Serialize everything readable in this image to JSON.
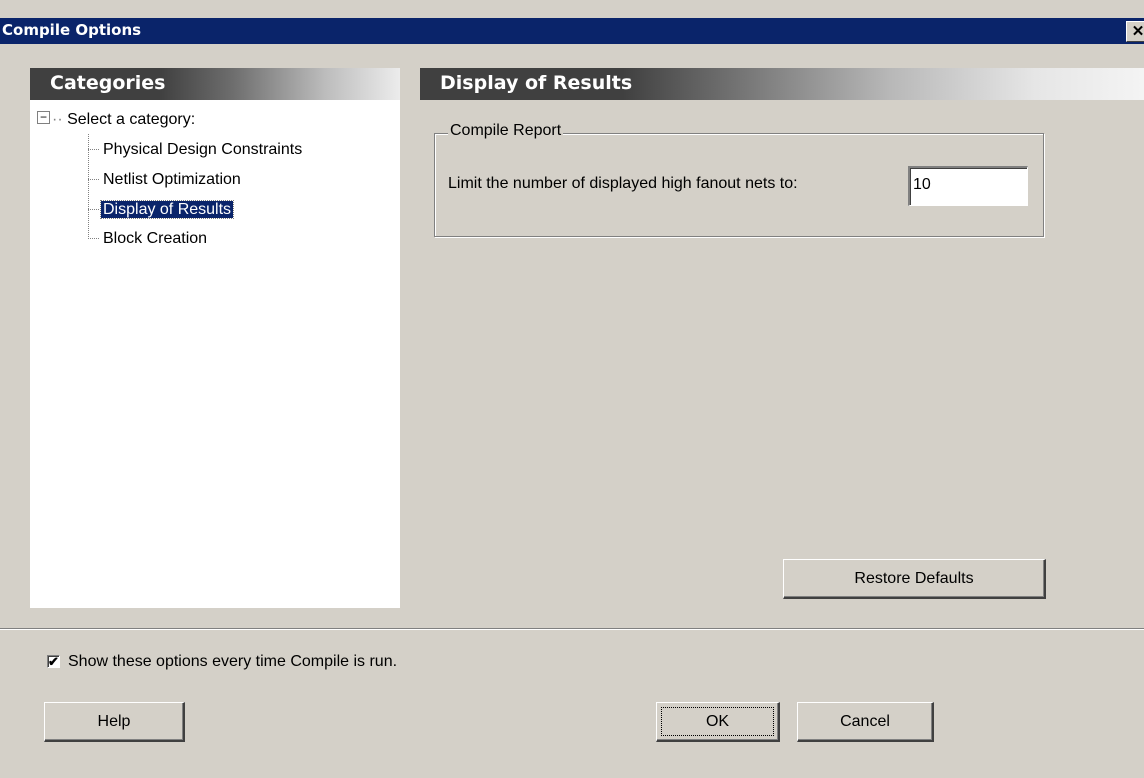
{
  "window": {
    "title": "Compile Options",
    "close_glyph": "✕"
  },
  "categories": {
    "header": "Categories",
    "root_label": "Select a category:",
    "root_expander": "−",
    "items": [
      {
        "label": "Physical Design Constraints"
      },
      {
        "label": "Netlist Optimization"
      },
      {
        "label": "Display of Results"
      },
      {
        "label": "Block Creation"
      }
    ],
    "selected": "Display of Results"
  },
  "content": {
    "header": "Display of Results",
    "group_title": "Compile Report",
    "fanout_label": "Limit the number of displayed high fanout nets to:",
    "fanout_value": "10",
    "restore_label": "Restore Defaults"
  },
  "footer": {
    "checkbox_label": "Show these options every time Compile is run.",
    "checkbox_checked": true,
    "checkbox_glyph": "✔",
    "help_label": "Help",
    "ok_label": "OK",
    "cancel_label": "Cancel"
  },
  "colors": {
    "titlebar": "#0a246a",
    "dialog_bg": "#d4d0c8",
    "selection": "#0a246a"
  },
  "icons": {
    "close": "close-icon",
    "expander": "tree-collapse-icon",
    "check": "checkmark-icon"
  }
}
